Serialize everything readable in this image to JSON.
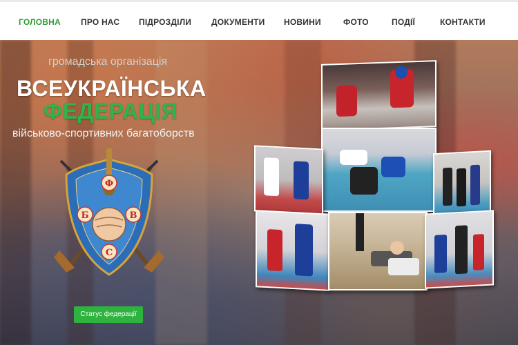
{
  "nav": {
    "items": [
      {
        "label": "ГОЛОВНА",
        "active": true
      },
      {
        "label": "ПРО НАС",
        "active": false
      },
      {
        "label": "ПІДРОЗДІЛИ",
        "active": false
      },
      {
        "label": "ДОКУМЕНТИ",
        "active": false
      },
      {
        "label": "НОВИНИ",
        "active": false
      },
      {
        "label": "ФОТО",
        "active": false
      },
      {
        "label": "ПОДІЇ",
        "active": false
      },
      {
        "label": "КОНТАКТИ",
        "active": false
      }
    ]
  },
  "hero": {
    "org_type": "громадська організація",
    "title_line1": "ВСЕУКРАЇНСЬКА",
    "title_line2": "ФЕДЕРАЦІЯ",
    "subtitle": "військово-спортивних багатоборств",
    "status_button": "Статус федерації"
  },
  "emblem": {
    "letters": [
      "Ф",
      "Б",
      "В",
      "С"
    ],
    "ring_text": "Всеукраїнська федерація військово-спортивних багатоборств",
    "icon": "shield-fist-crossed-rifles-icon"
  },
  "colors": {
    "accent_green": "#2eb33e",
    "nav_active": "#2e9d35",
    "nav_text": "#333333"
  }
}
